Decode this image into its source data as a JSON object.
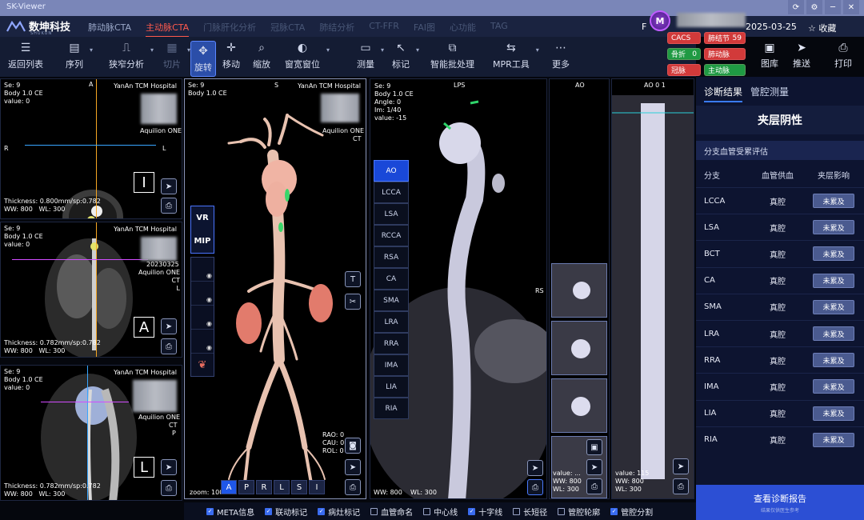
{
  "window": {
    "title": "SK-Viewer"
  },
  "brand": {
    "name": "数坤科技",
    "sub": "SHUKUN"
  },
  "nav_tabs": [
    {
      "label": "肺动脉CTA",
      "state": "normal"
    },
    {
      "label": "主动脉CTA",
      "state": "active"
    },
    {
      "label": "门脉肝化分析",
      "state": "dim"
    },
    {
      "label": "冠脉CTA",
      "state": "dim"
    },
    {
      "label": "肺结分析",
      "state": "dim"
    },
    {
      "label": "CT-FFR",
      "state": "dim"
    },
    {
      "label": "FAI图",
      "state": "dim"
    },
    {
      "label": "心功能",
      "state": "dim"
    },
    {
      "label": "TAG",
      "state": "dim"
    }
  ],
  "header": {
    "avatar_letter": "M",
    "date": "2025-03-25",
    "favorite": "收藏",
    "favorite_icon": "star-icon",
    "f_letter": "F"
  },
  "toolbar": [
    {
      "label": "返回列表",
      "icon": "list-icon"
    },
    {
      "label": "序列",
      "icon": "series-icon"
    },
    {
      "label": "狭窄分析",
      "icon": "stenosis-icon"
    },
    {
      "label": "切片",
      "icon": "slice-icon"
    },
    {
      "label": "旋转",
      "icon": "rotate-icon"
    },
    {
      "label": "移动",
      "icon": "move-icon"
    },
    {
      "label": "缩放",
      "icon": "zoom-icon"
    },
    {
      "label": "窗宽窗位",
      "icon": "window-level-icon"
    },
    {
      "label": "测量",
      "icon": "measure-icon"
    },
    {
      "label": "标记",
      "icon": "mark-icon"
    },
    {
      "label": "智能批处理",
      "icon": "batch-icon"
    },
    {
      "label": "MPR工具",
      "icon": "mpr-icon"
    },
    {
      "label": "更多",
      "icon": "more-icon"
    }
  ],
  "flags": [
    {
      "label": "CACS",
      "color": "#d23a3a"
    },
    {
      "label": "肺结节",
      "value": "59",
      "color": "#d23a3a"
    },
    {
      "label": "骨折",
      "value": "0",
      "color": "#1f9a43"
    },
    {
      "label": "肺动脉",
      "color": "#d23a3a"
    },
    {
      "label": "冠脉",
      "color": "#d23a3a"
    },
    {
      "label": "主动脉",
      "color": "#1f9a43"
    }
  ],
  "right_tools": [
    {
      "label": "图库",
      "icon": "gallery-icon"
    },
    {
      "label": "推送",
      "icon": "send-icon"
    },
    {
      "label": "打印",
      "icon": "print-icon"
    }
  ],
  "viewers": {
    "axial": {
      "se": "Se: 9",
      "body": "Body 1.0 CE",
      "value": "value: 0",
      "hospital": "YanAn TCM Hospital",
      "scanner": "Aquilion ONE",
      "top": "A",
      "left": "R",
      "right": "L",
      "thickness": "Thickness: 0.800mm/sp:0.782",
      "ww": "WW: 800",
      "wl": "WL: 300",
      "orient_letter": "I"
    },
    "coronal": {
      "se": "Se: 9",
      "body": "Body 1.0 CE",
      "value": "value: 0",
      "hospital": "YanAn TCM Hospital",
      "date": "20230325",
      "scanner": "Aquilion ONE",
      "modality": "CT",
      "right": "L",
      "thickness": "Thickness: 0.782mm/sp:0.782",
      "ww": "WW: 800",
      "wl": "WL: 300",
      "orient_letter": "A"
    },
    "sagittal": {
      "se": "Se: 9",
      "body": "Body 1.0 CE",
      "value": "value: 0",
      "hospital": "YanAn TCM Hospital",
      "scanner": "Aquilion ONE",
      "modality": "CT",
      "right": "P",
      "thickness": "Thickness: 0.782mm/sp:0.782",
      "ww": "WW: 800",
      "wl": "WL: 300",
      "orient_letter": "L"
    },
    "vr": {
      "se": "Se: 9",
      "body": "Body 1.0 CE",
      "top": "S",
      "hospital": "YanAn TCM Hospital",
      "scanner": "Aquilion ONE",
      "modality": "CT",
      "rao": "RAO: 0",
      "cau": "CAU: 0",
      "rol": "ROL: 0",
      "zoom": "zoom: 100",
      "vr_label": "VR",
      "mip_label": "MIP",
      "orient": [
        "A",
        "P",
        "R",
        "L",
        "S",
        "I"
      ]
    },
    "cpr": {
      "se": "Se: 9",
      "body": "Body 1.0 CE",
      "angle": "Angle: 0",
      "im": "Im: 1/40",
      "value": "value: -15",
      "top": "LPS",
      "right": "RS",
      "ww": "WW: 800",
      "wl": "WL: 300"
    },
    "ao_cross": {
      "title": "AO",
      "value": "value: ...",
      "ww": "WW: 800",
      "wl": "WL: 300"
    },
    "ao_straight": {
      "title": "AO 0 1",
      "value": "value: 115",
      "ww": "WW: 800",
      "wl": "WL: 300"
    }
  },
  "vessels": [
    "AO",
    "LCCA",
    "LSA",
    "RCCA",
    "RSA",
    "CA",
    "SMA",
    "LRA",
    "RRA",
    "IMA",
    "LIA",
    "RIA"
  ],
  "right_panel": {
    "tabs": [
      "诊断结果",
      "管腔测量"
    ],
    "conclusion": "夹层阴性",
    "section": "分支血管受累评估",
    "headers": [
      "分支",
      "血管供血",
      "夹层影响"
    ],
    "rows": [
      {
        "branch": "LCCA",
        "supply": "真腔",
        "effect": "未累及"
      },
      {
        "branch": "LSA",
        "supply": "真腔",
        "effect": "未累及"
      },
      {
        "branch": "BCT",
        "supply": "真腔",
        "effect": "未累及"
      },
      {
        "branch": "CA",
        "supply": "真腔",
        "effect": "未累及"
      },
      {
        "branch": "SMA",
        "supply": "真腔",
        "effect": "未累及"
      },
      {
        "branch": "LRA",
        "supply": "真腔",
        "effect": "未累及"
      },
      {
        "branch": "RRA",
        "supply": "真腔",
        "effect": "未累及"
      },
      {
        "branch": "IMA",
        "supply": "真腔",
        "effect": "未累及"
      },
      {
        "branch": "LIA",
        "supply": "真腔",
        "effect": "未累及"
      },
      {
        "branch": "RIA",
        "supply": "真腔",
        "effect": "未累及"
      }
    ],
    "report_button": "查看诊断报告",
    "report_sub": "结果仅供医生参考"
  },
  "bottom_options": [
    {
      "label": "META信息",
      "checked": true
    },
    {
      "label": "联动标记",
      "checked": true
    },
    {
      "label": "病灶标记",
      "checked": true
    },
    {
      "label": "血管命名",
      "checked": false
    },
    {
      "label": "中心线",
      "checked": false
    },
    {
      "label": "十字线",
      "checked": true
    },
    {
      "label": "长短径",
      "checked": false
    },
    {
      "label": "管腔轮廓",
      "checked": false
    },
    {
      "label": "管腔分割",
      "checked": true
    }
  ]
}
